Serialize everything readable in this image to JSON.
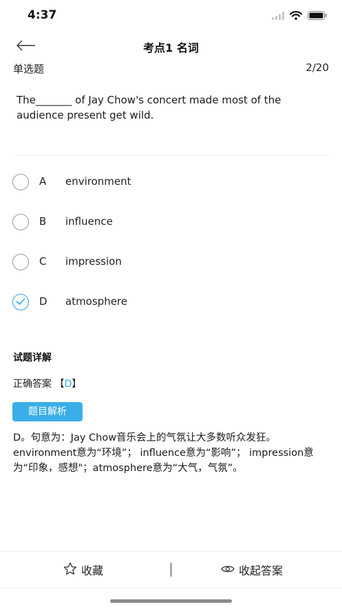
{
  "status_bar": {
    "time": "4:37",
    "icons": [
      "signal-icon",
      "wifi-icon",
      "battery-icon"
    ]
  },
  "nav": {
    "title": "考点1 名词",
    "back_icon": "back-arrow-icon"
  },
  "question": {
    "type": "单选题",
    "progress": "2/20",
    "text": "The_______ of Jay Chow's concert made most of the audience present get wild."
  },
  "options": [
    {
      "letter": "A",
      "text": "environment",
      "selected": false
    },
    {
      "letter": "B",
      "text": "influence",
      "selected": false
    },
    {
      "letter": "C",
      "text": "impression",
      "selected": false
    },
    {
      "letter": "D",
      "text": "atmosphere",
      "selected": true
    }
  ],
  "detail": {
    "title": "试题详解",
    "answer_prefix": "正确答案",
    "answer_open": "【",
    "answer_letter": "D",
    "answer_close": "】",
    "analysis_button": "题目解析",
    "analysis_text": "D。句意为：Jay Chow音乐会上的气氛让大多数听众发狂。 environment意为“环境”； influence意为“影响”； impression意为“印象，感想\"；atmosphere意为“大气，气氛”。"
  },
  "bottom_bar": {
    "favorite_label": "收藏",
    "favorite_icon": "star-icon",
    "hide_answer_label": "收起答案",
    "hide_answer_icon": "eye-icon"
  },
  "colors": {
    "accent": "#2aa4e4",
    "button_bg": "#3aaee8"
  }
}
